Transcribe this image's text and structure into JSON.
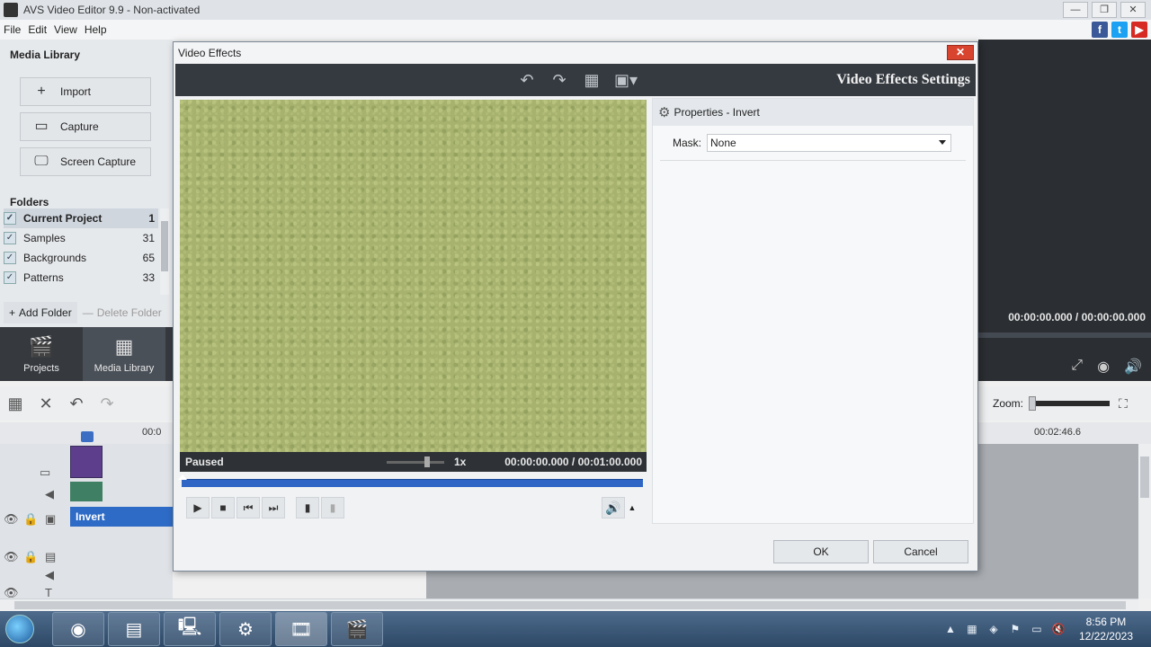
{
  "window": {
    "title": "AVS Video Editor 9.9 - Non-activated",
    "btn_min": "—",
    "btn_max": "❐",
    "btn_close": "✕"
  },
  "menu": [
    "File",
    "Edit",
    "View",
    "Help"
  ],
  "social": {
    "facebook": "f",
    "twitter": "t",
    "youtube": "▶"
  },
  "library": {
    "title": "Media Library",
    "buttons": [
      "Import",
      "Capture",
      "Screen Capture"
    ]
  },
  "folders": {
    "title": "Folders",
    "items": [
      {
        "name": "Current Project",
        "count": "1"
      },
      {
        "name": "Samples",
        "count": "31"
      },
      {
        "name": "Backgrounds",
        "count": "65"
      },
      {
        "name": "Patterns",
        "count": "33"
      }
    ],
    "add": "Add Folder",
    "delete": "Delete Folder"
  },
  "nav": {
    "projects": "Projects",
    "media": "Media Library"
  },
  "timeline": {
    "tick_left": "00:0",
    "tick_right": "00:02:46.6",
    "effect_label": "Invert"
  },
  "player": {
    "time": "00:00:00.000 / 00:00:00.000"
  },
  "zoom": {
    "label": "Zoom:"
  },
  "dialog": {
    "title": "Video Effects",
    "close": "✕",
    "heading": "Video Effects Settings",
    "status": "Paused",
    "speed": "1x",
    "time": "00:00:00.000  /  00:01:00.000",
    "props_title": "Properties - Invert",
    "mask_label": "Mask:",
    "mask_value": "None",
    "ok": "OK",
    "cancel": "Cancel"
  },
  "clock": {
    "time": "8:56 PM",
    "date": "12/22/2023"
  }
}
